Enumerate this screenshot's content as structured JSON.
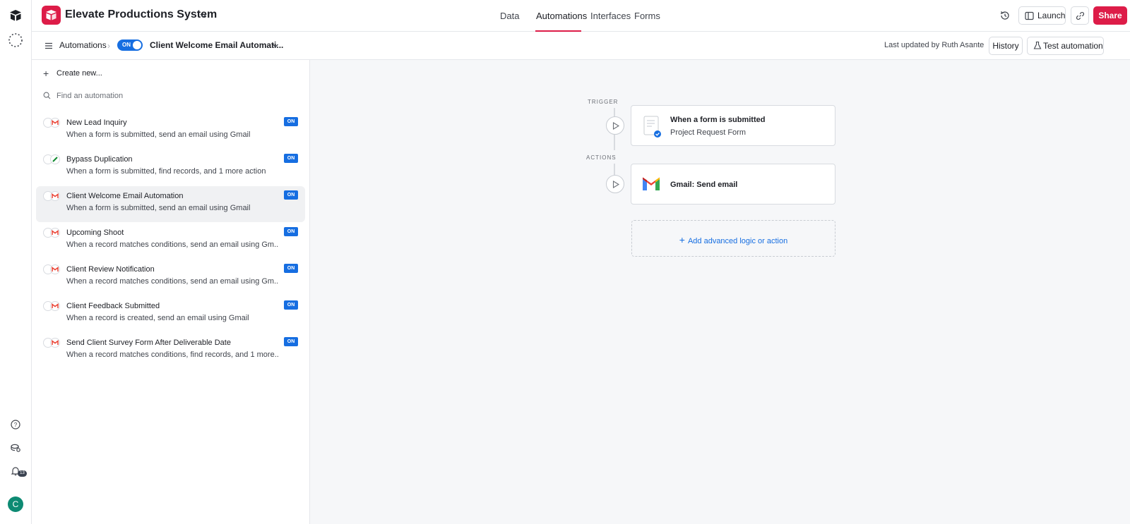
{
  "topbar": {
    "base_name": "Elevate Productions System",
    "tabs": [
      {
        "label": "Data"
      },
      {
        "label": "Automations"
      },
      {
        "label": "Interfaces"
      },
      {
        "label": "Forms"
      }
    ],
    "launch_label": "Launch",
    "share_label": "Share",
    "brand_color": "#dd1c48"
  },
  "subbar": {
    "breadcrumb": "Automations",
    "toggle_label": "ON",
    "automation_title": "Client Welcome Email Automati...",
    "last_updated": "Last updated by Ruth Asante",
    "history_label": "History",
    "test_label": "Test automation"
  },
  "sidebar": {
    "create_label": "Create new...",
    "search_placeholder": "Find an automation",
    "items": [
      {
        "title": "New Lead Inquiry",
        "desc": "When a form is submitted, send an email using Gmail",
        "status": "ON",
        "selected": false
      },
      {
        "title": "Bypass Duplication",
        "desc": "When a form is submitted, find records, and 1 more action",
        "status": "ON",
        "selected": false
      },
      {
        "title": "Client Welcome Email Automation",
        "desc": "When a form is submitted, send an email using Gmail",
        "status": "ON",
        "selected": true
      },
      {
        "title": "Upcoming Shoot",
        "desc": "When a record matches conditions, send an email using Gm...",
        "status": "ON",
        "selected": false
      },
      {
        "title": "Client Review Notification",
        "desc": "When a record matches conditions, send an email using Gm...",
        "status": "ON",
        "selected": false
      },
      {
        "title": "Client Feedback Submitted",
        "desc": "When a record is created, send an email using Gmail",
        "status": "ON",
        "selected": false
      },
      {
        "title": "Send Client Survey Form After Deliverable Date",
        "desc": "When a record matches conditions, find records, and 1 more...",
        "status": "ON",
        "selected": false
      }
    ]
  },
  "canvas": {
    "trigger_label": "TRIGGER",
    "actions_label": "ACTIONS",
    "trigger": {
      "title": "When a form is submitted",
      "subtitle": "Project Request Form"
    },
    "action": {
      "title": "Gmail: Send email"
    },
    "add_label": "Add advanced logic or action"
  },
  "rail": {
    "notification_count": "13",
    "avatar_initial": "C"
  },
  "colors": {
    "accent": "#166ee1",
    "brand": "#dd1c48"
  }
}
